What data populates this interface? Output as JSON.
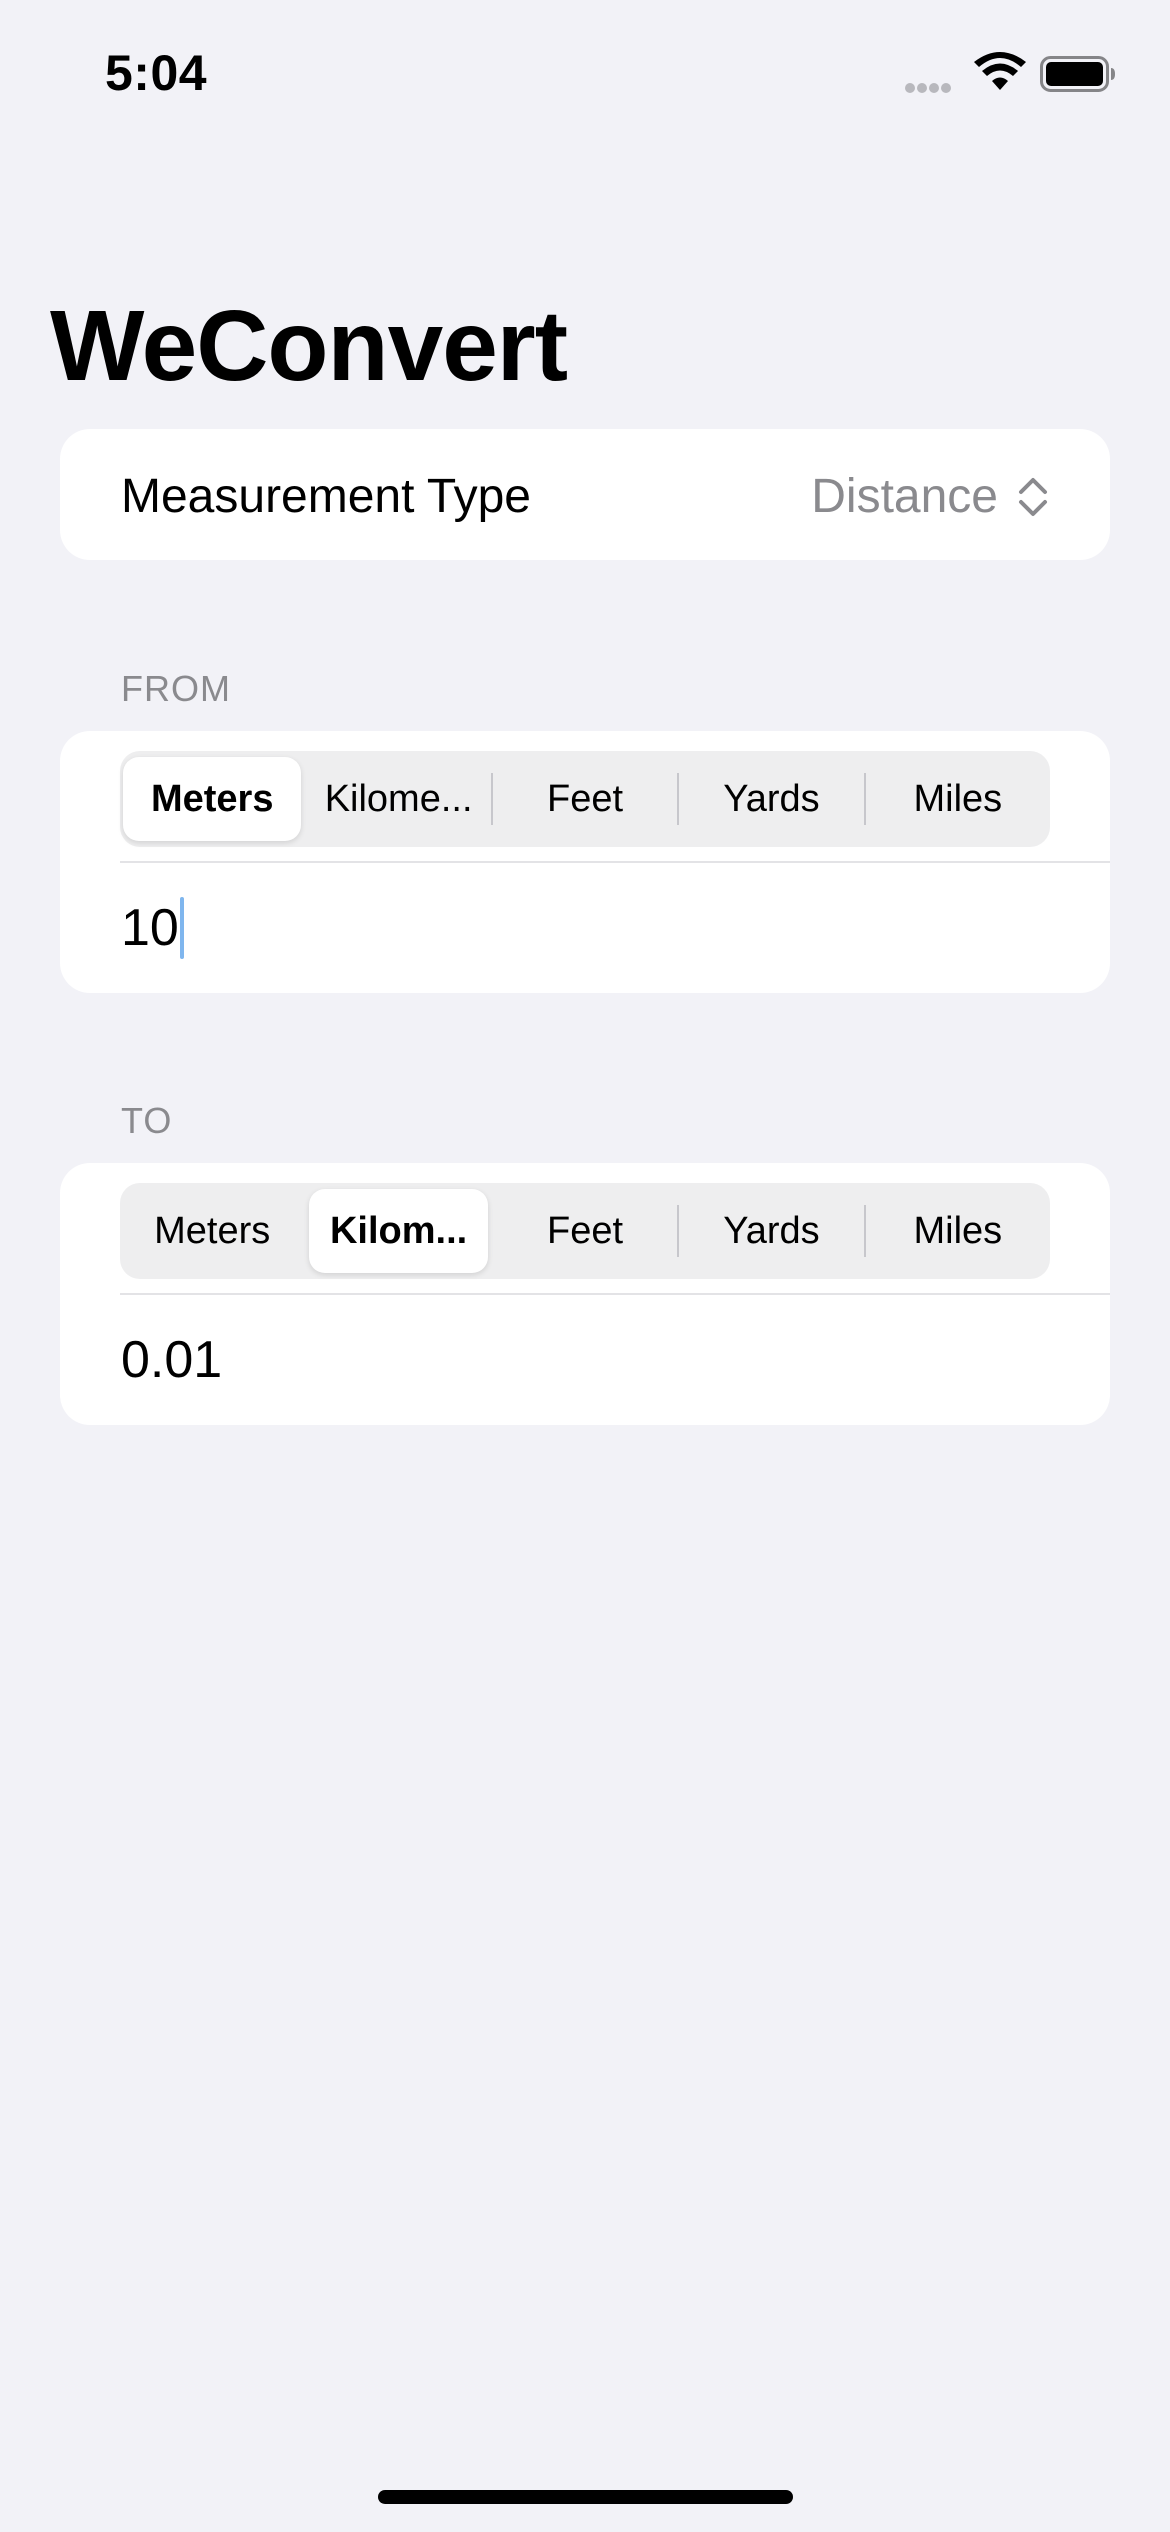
{
  "status_bar": {
    "time": "5:04"
  },
  "app": {
    "title": "WeConvert"
  },
  "measurement": {
    "label": "Measurement Type",
    "value": "Distance"
  },
  "from_section": {
    "header": "FROM",
    "segments": [
      "Meters",
      "Kilome...",
      "Feet",
      "Yards",
      "Miles"
    ],
    "selected_index": 0,
    "value": "10"
  },
  "to_section": {
    "header": "TO",
    "segments": [
      "Meters",
      "Kilom...",
      "Feet",
      "Yards",
      "Miles"
    ],
    "selected_index": 1,
    "value": "0.01"
  },
  "colors": {
    "background": "#f2f2f7",
    "card": "#ffffff",
    "secondary_text": "#8a8a8e",
    "segment_track": "#eeeeef",
    "caret": "#7fb6ee"
  },
  "icons": {
    "measure_picker": "chevron-up-down-icon",
    "status_signal": "cellular-signal-icon",
    "status_wifi": "wifi-icon",
    "status_battery": "battery-icon"
  }
}
